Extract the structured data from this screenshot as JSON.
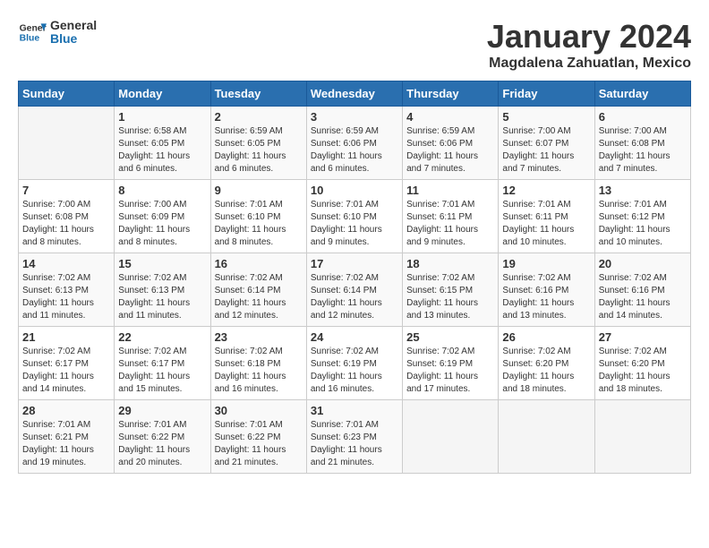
{
  "logo": {
    "text_general": "General",
    "text_blue": "Blue"
  },
  "title": "January 2024",
  "subtitle": "Magdalena Zahuatlan, Mexico",
  "days_header": [
    "Sunday",
    "Monday",
    "Tuesday",
    "Wednesday",
    "Thursday",
    "Friday",
    "Saturday"
  ],
  "weeks": [
    [
      {
        "day": "",
        "sunrise": "",
        "sunset": "",
        "daylight": ""
      },
      {
        "day": "1",
        "sunrise": "Sunrise: 6:58 AM",
        "sunset": "Sunset: 6:05 PM",
        "daylight": "Daylight: 11 hours and 6 minutes."
      },
      {
        "day": "2",
        "sunrise": "Sunrise: 6:59 AM",
        "sunset": "Sunset: 6:05 PM",
        "daylight": "Daylight: 11 hours and 6 minutes."
      },
      {
        "day": "3",
        "sunrise": "Sunrise: 6:59 AM",
        "sunset": "Sunset: 6:06 PM",
        "daylight": "Daylight: 11 hours and 6 minutes."
      },
      {
        "day": "4",
        "sunrise": "Sunrise: 6:59 AM",
        "sunset": "Sunset: 6:06 PM",
        "daylight": "Daylight: 11 hours and 7 minutes."
      },
      {
        "day": "5",
        "sunrise": "Sunrise: 7:00 AM",
        "sunset": "Sunset: 6:07 PM",
        "daylight": "Daylight: 11 hours and 7 minutes."
      },
      {
        "day": "6",
        "sunrise": "Sunrise: 7:00 AM",
        "sunset": "Sunset: 6:08 PM",
        "daylight": "Daylight: 11 hours and 7 minutes."
      }
    ],
    [
      {
        "day": "7",
        "sunrise": "Sunrise: 7:00 AM",
        "sunset": "Sunset: 6:08 PM",
        "daylight": "Daylight: 11 hours and 8 minutes."
      },
      {
        "day": "8",
        "sunrise": "Sunrise: 7:00 AM",
        "sunset": "Sunset: 6:09 PM",
        "daylight": "Daylight: 11 hours and 8 minutes."
      },
      {
        "day": "9",
        "sunrise": "Sunrise: 7:01 AM",
        "sunset": "Sunset: 6:10 PM",
        "daylight": "Daylight: 11 hours and 8 minutes."
      },
      {
        "day": "10",
        "sunrise": "Sunrise: 7:01 AM",
        "sunset": "Sunset: 6:10 PM",
        "daylight": "Daylight: 11 hours and 9 minutes."
      },
      {
        "day": "11",
        "sunrise": "Sunrise: 7:01 AM",
        "sunset": "Sunset: 6:11 PM",
        "daylight": "Daylight: 11 hours and 9 minutes."
      },
      {
        "day": "12",
        "sunrise": "Sunrise: 7:01 AM",
        "sunset": "Sunset: 6:11 PM",
        "daylight": "Daylight: 11 hours and 10 minutes."
      },
      {
        "day": "13",
        "sunrise": "Sunrise: 7:01 AM",
        "sunset": "Sunset: 6:12 PM",
        "daylight": "Daylight: 11 hours and 10 minutes."
      }
    ],
    [
      {
        "day": "14",
        "sunrise": "Sunrise: 7:02 AM",
        "sunset": "Sunset: 6:13 PM",
        "daylight": "Daylight: 11 hours and 11 minutes."
      },
      {
        "day": "15",
        "sunrise": "Sunrise: 7:02 AM",
        "sunset": "Sunset: 6:13 PM",
        "daylight": "Daylight: 11 hours and 11 minutes."
      },
      {
        "day": "16",
        "sunrise": "Sunrise: 7:02 AM",
        "sunset": "Sunset: 6:14 PM",
        "daylight": "Daylight: 11 hours and 12 minutes."
      },
      {
        "day": "17",
        "sunrise": "Sunrise: 7:02 AM",
        "sunset": "Sunset: 6:14 PM",
        "daylight": "Daylight: 11 hours and 12 minutes."
      },
      {
        "day": "18",
        "sunrise": "Sunrise: 7:02 AM",
        "sunset": "Sunset: 6:15 PM",
        "daylight": "Daylight: 11 hours and 13 minutes."
      },
      {
        "day": "19",
        "sunrise": "Sunrise: 7:02 AM",
        "sunset": "Sunset: 6:16 PM",
        "daylight": "Daylight: 11 hours and 13 minutes."
      },
      {
        "day": "20",
        "sunrise": "Sunrise: 7:02 AM",
        "sunset": "Sunset: 6:16 PM",
        "daylight": "Daylight: 11 hours and 14 minutes."
      }
    ],
    [
      {
        "day": "21",
        "sunrise": "Sunrise: 7:02 AM",
        "sunset": "Sunset: 6:17 PM",
        "daylight": "Daylight: 11 hours and 14 minutes."
      },
      {
        "day": "22",
        "sunrise": "Sunrise: 7:02 AM",
        "sunset": "Sunset: 6:17 PM",
        "daylight": "Daylight: 11 hours and 15 minutes."
      },
      {
        "day": "23",
        "sunrise": "Sunrise: 7:02 AM",
        "sunset": "Sunset: 6:18 PM",
        "daylight": "Daylight: 11 hours and 16 minutes."
      },
      {
        "day": "24",
        "sunrise": "Sunrise: 7:02 AM",
        "sunset": "Sunset: 6:19 PM",
        "daylight": "Daylight: 11 hours and 16 minutes."
      },
      {
        "day": "25",
        "sunrise": "Sunrise: 7:02 AM",
        "sunset": "Sunset: 6:19 PM",
        "daylight": "Daylight: 11 hours and 17 minutes."
      },
      {
        "day": "26",
        "sunrise": "Sunrise: 7:02 AM",
        "sunset": "Sunset: 6:20 PM",
        "daylight": "Daylight: 11 hours and 18 minutes."
      },
      {
        "day": "27",
        "sunrise": "Sunrise: 7:02 AM",
        "sunset": "Sunset: 6:20 PM",
        "daylight": "Daylight: 11 hours and 18 minutes."
      }
    ],
    [
      {
        "day": "28",
        "sunrise": "Sunrise: 7:01 AM",
        "sunset": "Sunset: 6:21 PM",
        "daylight": "Daylight: 11 hours and 19 minutes."
      },
      {
        "day": "29",
        "sunrise": "Sunrise: 7:01 AM",
        "sunset": "Sunset: 6:22 PM",
        "daylight": "Daylight: 11 hours and 20 minutes."
      },
      {
        "day": "30",
        "sunrise": "Sunrise: 7:01 AM",
        "sunset": "Sunset: 6:22 PM",
        "daylight": "Daylight: 11 hours and 21 minutes."
      },
      {
        "day": "31",
        "sunrise": "Sunrise: 7:01 AM",
        "sunset": "Sunset: 6:23 PM",
        "daylight": "Daylight: 11 hours and 21 minutes."
      },
      {
        "day": "",
        "sunrise": "",
        "sunset": "",
        "daylight": ""
      },
      {
        "day": "",
        "sunrise": "",
        "sunset": "",
        "daylight": ""
      },
      {
        "day": "",
        "sunrise": "",
        "sunset": "",
        "daylight": ""
      }
    ]
  ]
}
